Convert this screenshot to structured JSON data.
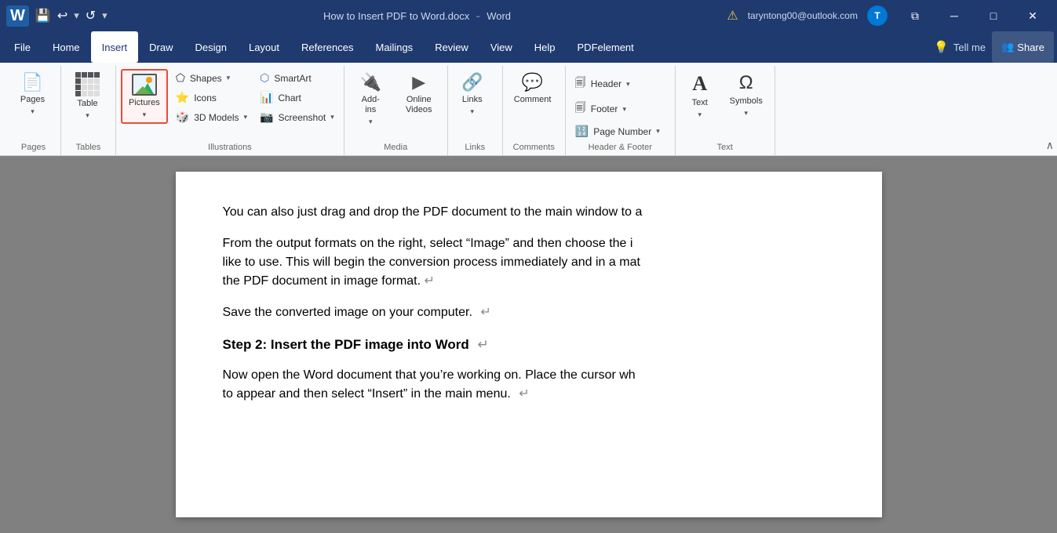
{
  "titlebar": {
    "document_name": "How to Insert PDF to Word.docx",
    "app_name": "Word",
    "separator": "-",
    "warning_icon": "⚠",
    "user_email": "taryntong00@outlook.com",
    "user_initial": "T",
    "save_icon": "💾",
    "undo_icon": "↩",
    "redo_icon": "↪",
    "customize_icon": "▼",
    "minimize_label": "─",
    "restore_label": "⧉",
    "close_label": "✕"
  },
  "menubar": {
    "items": [
      {
        "label": "File",
        "active": false
      },
      {
        "label": "Home",
        "active": false
      },
      {
        "label": "Insert",
        "active": true
      },
      {
        "label": "Draw",
        "active": false
      },
      {
        "label": "Design",
        "active": false
      },
      {
        "label": "Layout",
        "active": false
      },
      {
        "label": "References",
        "active": false
      },
      {
        "label": "Mailings",
        "active": false
      },
      {
        "label": "Review",
        "active": false
      },
      {
        "label": "View",
        "active": false
      },
      {
        "label": "Help",
        "active": false
      },
      {
        "label": "PDFelement",
        "active": false
      }
    ],
    "tell_me": "Tell me",
    "share": "Share"
  },
  "ribbon": {
    "groups": {
      "pages": {
        "label": "Pages",
        "buttons": [
          {
            "label": "Pages",
            "icon": "📄"
          }
        ]
      },
      "tables": {
        "label": "Tables",
        "buttons": [
          {
            "label": "Table",
            "icon": "⊞"
          }
        ]
      },
      "illustrations": {
        "label": "Illustrations",
        "pictures_label": "Pictures",
        "shapes_label": "Shapes",
        "icons_label": "Icons",
        "3d_models_label": "3D Models",
        "smartart_label": "SmartArt",
        "chart_label": "Chart",
        "screenshot_label": "Screenshot"
      },
      "media": {
        "label": "Media",
        "addins_label": "Add-\nins",
        "onlinevideos_label": "Online\nVideos"
      },
      "links": {
        "label": "Links",
        "links_label": "Links"
      },
      "comments": {
        "label": "Comments",
        "comment_label": "Comment"
      },
      "header_footer": {
        "label": "Header & Footer",
        "header_label": "Header",
        "footer_label": "Footer",
        "page_number_label": "Page Number"
      },
      "text": {
        "label": "Text",
        "text_label": "Text",
        "symbols_label": "Symbols"
      }
    }
  },
  "document": {
    "para1": "You can also just drag and drop the PDF document to the main window to a",
    "para2_line1": "From the output formats on the right, select “Image” and then choose the i",
    "para2_line2": "like to use. This will begin the conversion process immediately and in a mat",
    "para2_line3": "the PDF document in image format.",
    "para3": "Save the converted image on your computer.",
    "step2_heading": "Step 2: Insert the PDF image into Word",
    "para4_line1": "Now open the Word document that you’re working on. Place the cursor wh",
    "para4_line2": "to appear and then select “Insert” in the main menu.",
    "para_mark": "↵"
  }
}
